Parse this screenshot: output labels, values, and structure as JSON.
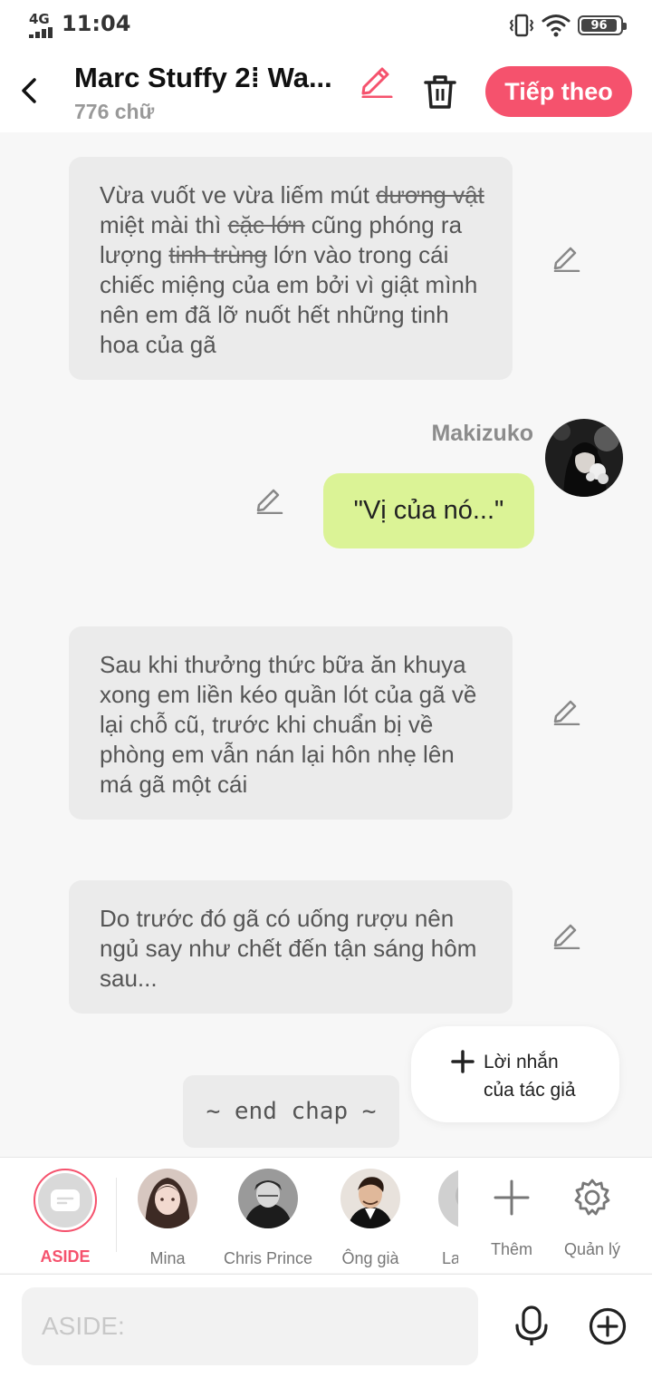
{
  "status_bar": {
    "network": "4G",
    "time": "11:04",
    "battery": "96",
    "icons": [
      "vibrate-icon",
      "wifi-icon",
      "battery-icon"
    ]
  },
  "header": {
    "title": "Marc Stuffy 2⁞   Wa...",
    "word_count": "776 chữ",
    "next_button": "Tiếp theo",
    "icons": [
      "back-arrow-icon",
      "edit-pencil-icon",
      "trash-icon"
    ]
  },
  "messages": [
    {
      "type": "narration",
      "segments": [
        {
          "text": "Vừa vuốt ve vừa liếm mút ",
          "strike": false
        },
        {
          "text": "dương vật",
          "strike": true
        },
        {
          "text": " miệt mài thì ",
          "strike": false
        },
        {
          "text": "cặc lớn",
          "strike": true
        },
        {
          "text": " cũng phóng ra lượng ",
          "strike": false
        },
        {
          "text": " tinh trùng",
          "strike": true
        },
        {
          "text": " lớn vào trong cái chiếc miệng của em bởi vì giật mình nên em đã lỡ nuốt hết những tinh hoa của gã",
          "strike": false
        }
      ]
    },
    {
      "type": "dialogue",
      "speaker": "Makizuko",
      "text": "\"Vị của nó...\""
    },
    {
      "type": "narration",
      "text": "Sau khi thưởng thức bữa ăn khuya xong em liền kéo quần lót của gã về lại chỗ cũ, trước khi chuẩn bị về phòng em vẫn nán lại hôn nhẹ lên má gã một cái"
    },
    {
      "type": "narration",
      "text": "Do trước đó gã có uống rượu nên ngủ say như chết đến tận sáng hôm sau..."
    }
  ],
  "author_note": {
    "line1": "Lời nhắn",
    "line2": "của tác giả"
  },
  "end_chap": "~ end chap ~",
  "characters": [
    {
      "name": "ASIDE",
      "selected": true
    },
    {
      "name": "Mina"
    },
    {
      "name": "Chris Prince"
    },
    {
      "name": "Ông già"
    },
    {
      "name": "La"
    }
  ],
  "tools": {
    "add": "Thêm",
    "manage": "Quản lý"
  },
  "input": {
    "placeholder": "ASIDE:",
    "value": ""
  },
  "colors": {
    "accent": "#f5526d",
    "dialogue_bubble": "#dbf396",
    "narration_bubble": "#ebebeb",
    "background": "#f7f7f7"
  }
}
